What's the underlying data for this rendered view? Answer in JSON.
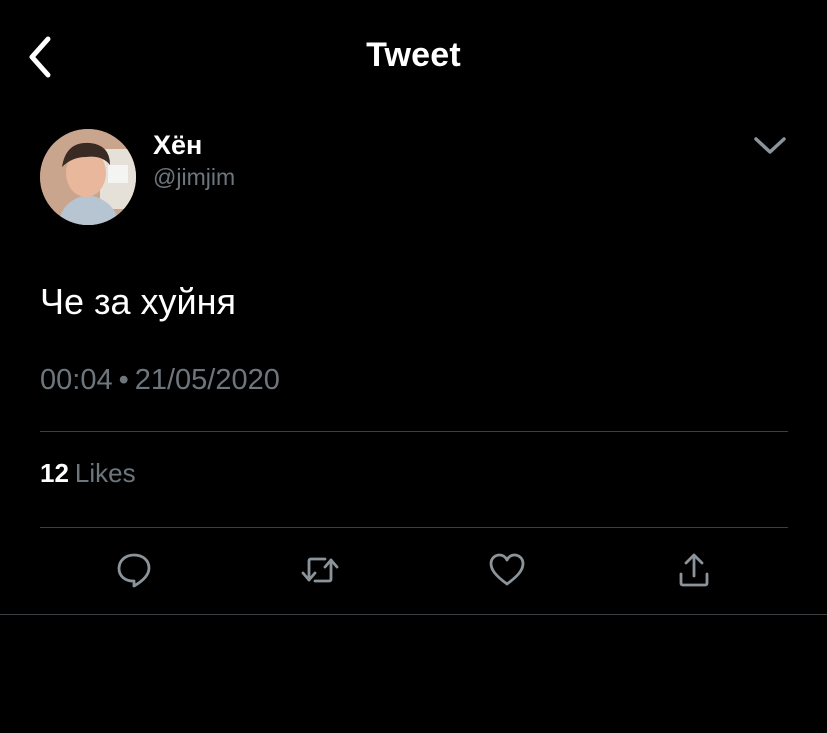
{
  "header": {
    "title": "Tweet",
    "back_icon": "chevron-left-icon"
  },
  "author": {
    "display_name": "Хён",
    "handle": "@jimjim",
    "avatar_icon": "profile-photo",
    "more_icon": "chevron-down-icon"
  },
  "tweet": {
    "text": "Че за хуйня",
    "time": "00:04",
    "separator": "•",
    "date": "21/05/2020"
  },
  "stats": {
    "likes_count": "12",
    "likes_label": "Likes"
  },
  "actions": [
    {
      "name": "reply-icon"
    },
    {
      "name": "retweet-icon"
    },
    {
      "name": "like-icon"
    },
    {
      "name": "share-icon"
    }
  ],
  "colors": {
    "background": "#000000",
    "text_primary": "#ffffff",
    "text_secondary": "#6e767d",
    "divider": "#3a3f44"
  }
}
